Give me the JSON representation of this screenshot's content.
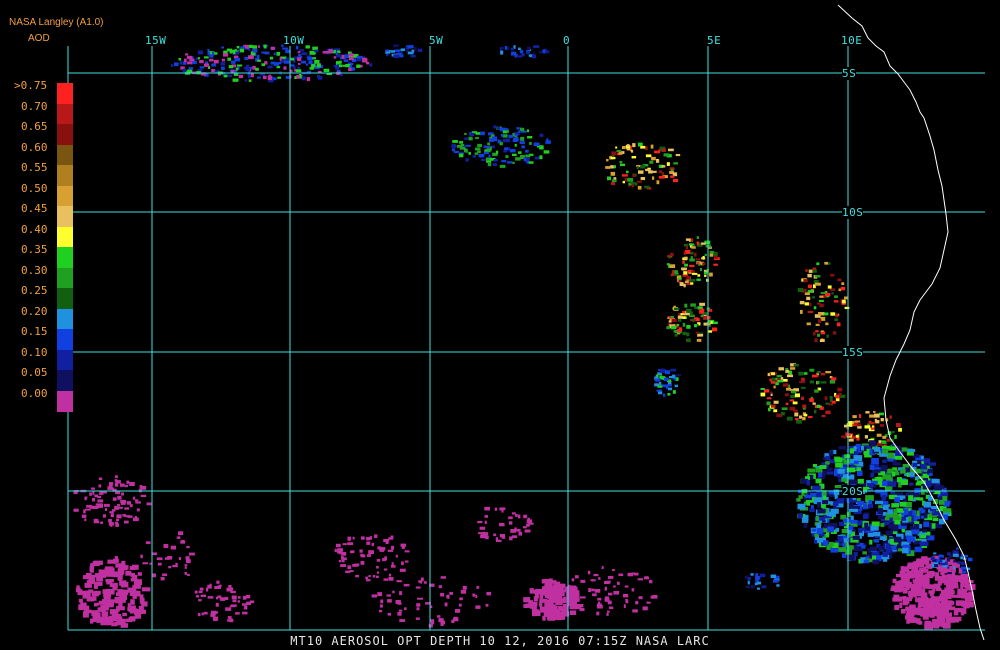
{
  "header": {
    "source": "NASA Langley (A1.0)",
    "product": "AOD"
  },
  "legend": {
    "labels": [
      ">0.75",
      "0.70",
      "0.65",
      "0.60",
      "0.55",
      "0.50",
      "0.45",
      "0.40",
      "0.35",
      "0.30",
      "0.25",
      "0.20",
      "0.15",
      "0.10",
      "0.05",
      "0.00"
    ],
    "colors": [
      "#ff2020",
      "#b81818",
      "#8a1010",
      "#7a5510",
      "#b08020",
      "#d8a030",
      "#e8c060",
      "#ffff30",
      "#20d020",
      "#20a020",
      "#106010",
      "#2090e0",
      "#1040e0",
      "#1020a0",
      "#101060",
      "#c030a0"
    ]
  },
  "grid": {
    "lon_labels": [
      "15W",
      "10W",
      "5W",
      "0",
      "5E",
      "10E"
    ],
    "lat_labels": [
      "5S",
      "10S",
      "15S",
      "20S"
    ]
  },
  "footer": "MT10  AEROSOL OPT DEPTH   10 12, 2016 07:15Z   NASA LARC",
  "colors": {
    "grid": "#40e0e0",
    "coast": "#ffffff",
    "text_orange": "#f0a040"
  }
}
